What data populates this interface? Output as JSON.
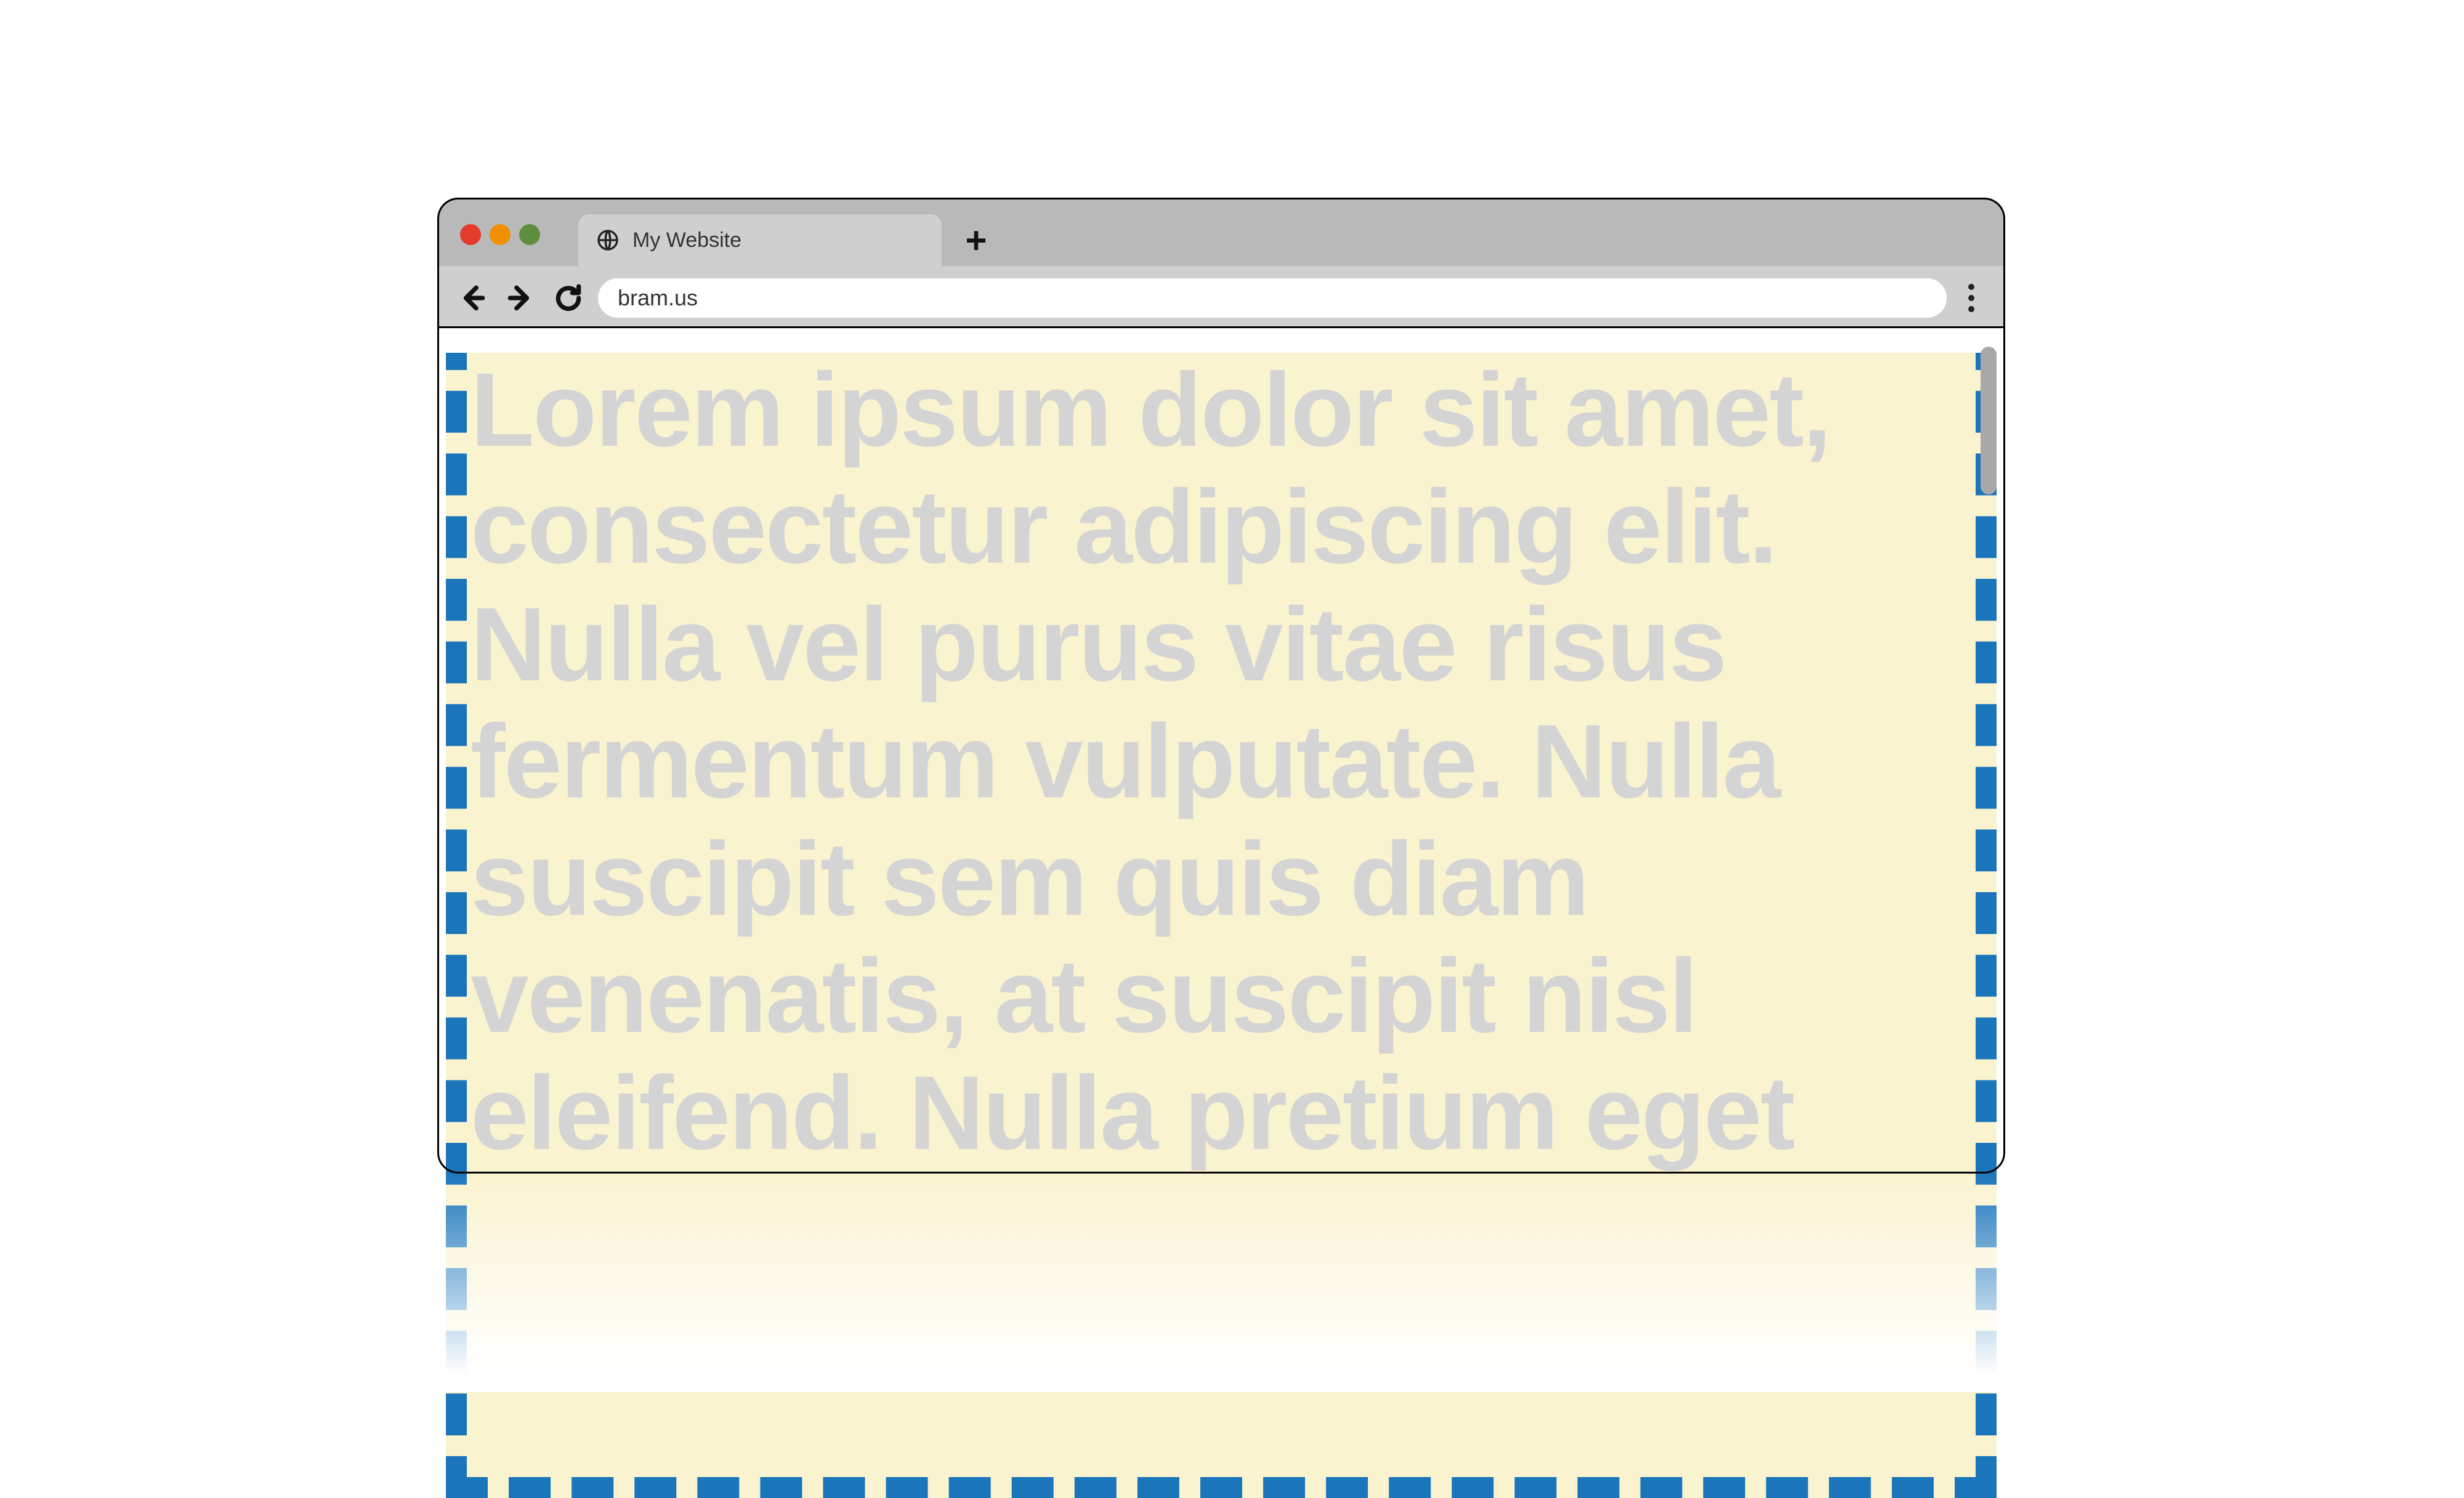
{
  "browser": {
    "tab_title": "My Website",
    "url": "bram.us",
    "new_tab_glyph": "+",
    "favicon_glyph": "⎘"
  },
  "icons": {
    "back": "←",
    "forward": "→",
    "reload": "↻",
    "menu": "⋮"
  },
  "page": {
    "body_text": "Lorem ipsum dolor sit amet, consectetur adipiscing elit. Nulla vel purus vitae risus fermentum vulputate. Nulla suscipit sem quis diam venenatis, at suscipit nisl eleifend. Nulla pretium eget"
  },
  "colors": {
    "page_bg": "#faf3cf",
    "dashed_border": "#1a75bb",
    "text": "#d4d4d4",
    "chrome_tabstrip": "#b9b9b9",
    "chrome_toolbar": "#cfcfcf"
  }
}
